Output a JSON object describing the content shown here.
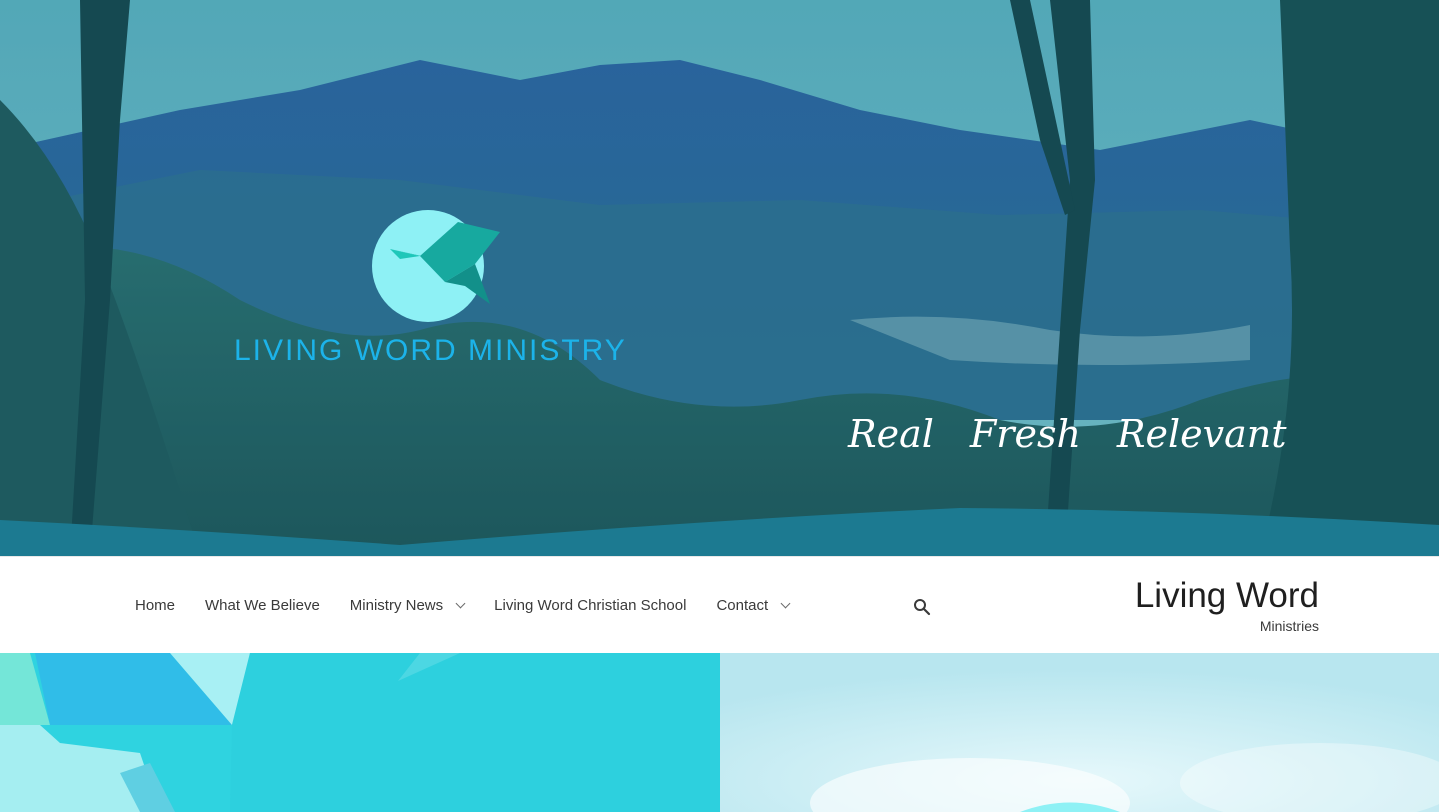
{
  "hero": {
    "logo_text": "LIVING WORD MINISTRY",
    "tagline": [
      "Real",
      "Fresh",
      "Relevant"
    ],
    "colors": {
      "logo_text": "#1cb3ea",
      "logo_circle": "#8ef1f5",
      "bird": "#17b3a9",
      "overlay": "#1e7a95"
    }
  },
  "nav": {
    "items": [
      {
        "label": "Home",
        "has_dropdown": false
      },
      {
        "label": "What We Believe",
        "has_dropdown": false
      },
      {
        "label": "Ministry News",
        "has_dropdown": true
      },
      {
        "label": "Living Word Christian School",
        "has_dropdown": false
      },
      {
        "label": "Contact",
        "has_dropdown": true
      }
    ],
    "search_icon": "search-icon"
  },
  "site": {
    "title": "Living Word",
    "subtitle": "Ministries"
  }
}
